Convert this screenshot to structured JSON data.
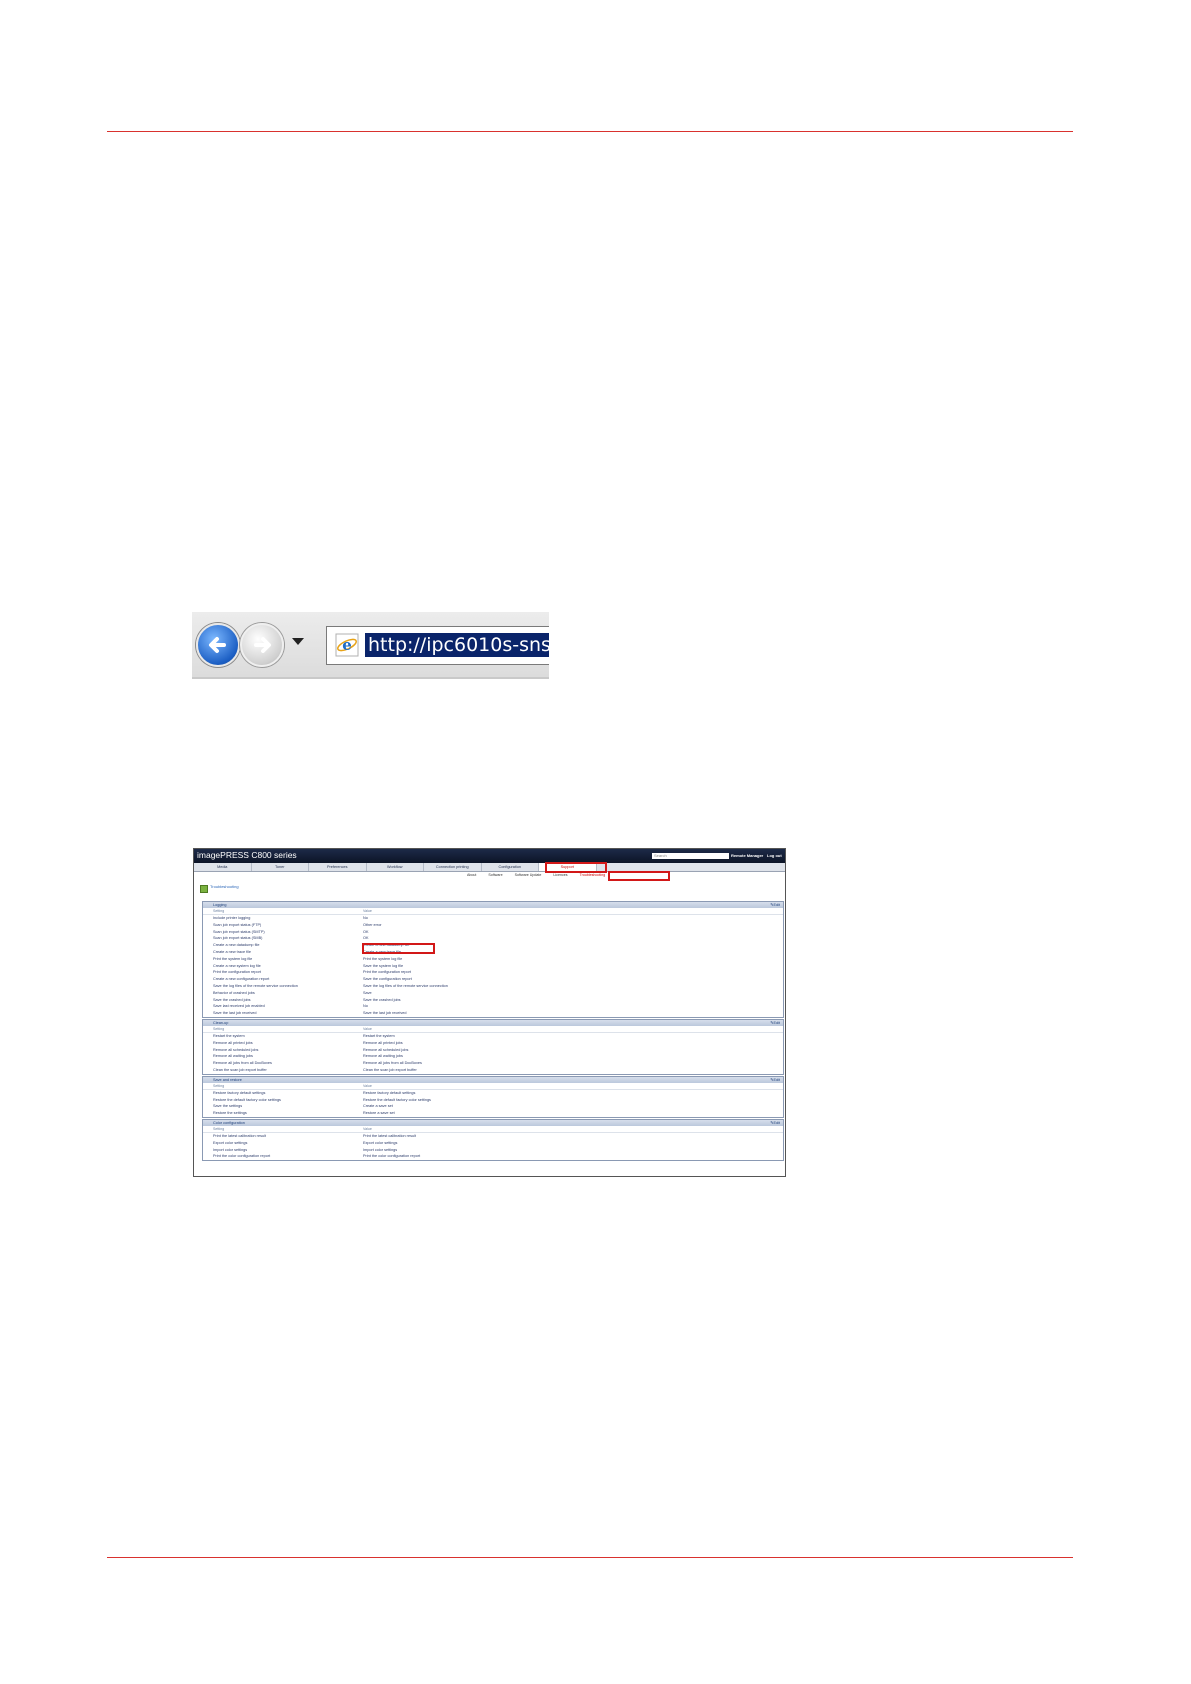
{
  "colors": {
    "rule": "#d9322e",
    "highlight": "#d21818",
    "title_bar": "#121c33"
  },
  "browser": {
    "back_icon": "back-arrow-icon",
    "forward_icon": "forward-arrow-icon",
    "address_url": "http://ipc6010s-sns"
  },
  "app": {
    "title": "imagePRESS C800 series",
    "search_placeholder": "Search",
    "user": "Remote Manager",
    "logout": "Log out",
    "tabs": [
      "Media",
      "Toner",
      "Preferences",
      "Workflow",
      "Connection printing",
      "Configuration",
      "Support"
    ],
    "active_tab": "Support",
    "subtabs": [
      "About",
      "Software",
      "Software Update",
      "Licences",
      "Troubleshooting"
    ],
    "page_heading": "Troubleshooting",
    "col_setting": "Setting",
    "col_value": "Value",
    "edit_label": "Edit",
    "sections": [
      {
        "title": "Logging",
        "rows": [
          [
            "Include printer logging",
            "No"
          ],
          [
            "Scan job export status (FTP)",
            "Other error"
          ],
          [
            "Scan job export status (SMTP)",
            "OK"
          ],
          [
            "Scan job export status (SMB)",
            "OK"
          ],
          [
            "Create a new datadump file",
            "Create a new datadump file"
          ],
          [
            "Create a new trace file",
            "Create a new trace file"
          ],
          [
            "Print the system log file",
            "Print the system log file"
          ],
          [
            "Create a new system log file",
            "Save the system log file"
          ],
          [
            "Print the configuration report",
            "Print the configuration report"
          ],
          [
            "Create a new configuration report",
            "Save the configuration report"
          ],
          [
            "Save the log files of the remote service connection",
            "Save the log files of the remote service connection"
          ],
          [
            "Behavior of crashed jobs",
            "Save"
          ],
          [
            "Save the crashed jobs",
            "Save the crashed jobs"
          ],
          [
            "Save last received job enabled",
            "No"
          ],
          [
            "Save the last job received",
            "Save the last job received"
          ]
        ]
      },
      {
        "title": "Clean-up",
        "rows": [
          [
            "Restart the system",
            "Restart the system"
          ],
          [
            "Remove all printed jobs",
            "Remove all printed jobs"
          ],
          [
            "Remove all scheduled jobs",
            "Remove all scheduled jobs"
          ],
          [
            "Remove all waiting jobs",
            "Remove all waiting jobs"
          ],
          [
            "Remove all jobs from all DocBoxes",
            "Remove all jobs from all DocBoxes"
          ],
          [
            "Clean the scan job export buffer",
            "Clean the scan job export buffer"
          ]
        ]
      },
      {
        "title": "Save and restore",
        "rows": [
          [
            "Restore factory default settings",
            "Restore factory default settings"
          ],
          [
            "Restore the default factory color settings",
            "Restore the default factory color settings"
          ],
          [
            "Save the settings",
            "Create a save set"
          ],
          [
            "Restore the settings",
            "Restore a save set"
          ]
        ]
      },
      {
        "title": "Color configuration",
        "rows": [
          [
            "Print the latest calibration result",
            "Print the latest calibration result"
          ],
          [
            "Export color settings",
            "Export color settings"
          ],
          [
            "Import color settings",
            "Import color settings"
          ],
          [
            "Print the color configuration report",
            "Print the color configuration report"
          ]
        ]
      }
    ]
  }
}
